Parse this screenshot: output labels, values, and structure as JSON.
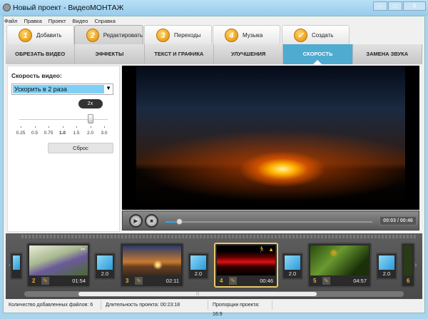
{
  "window": {
    "title": "Новый проект - ВидеоМОНТАЖ",
    "minimize": "–",
    "maximize": "□",
    "close": "X"
  },
  "menu": [
    "Файл",
    "Правка",
    "Проект",
    "Видео",
    "Справка"
  ],
  "steps": [
    {
      "num": "1",
      "label": "Добавить"
    },
    {
      "num": "2",
      "label": "Редактировать"
    },
    {
      "num": "3",
      "label": "Переходы"
    },
    {
      "num": "4",
      "label": "Музыка"
    },
    {
      "num": "✓",
      "label": "Создать"
    }
  ],
  "subtabs": [
    "ОБРЕЗАТЬ ВИДЕО",
    "ЭФФЕКТЫ",
    "ТЕКСТ И ГРАФИКА",
    "УЛУЧШЕНИЯ",
    "СКОРОСТЬ",
    "ЗАМЕНА ЗВУКА"
  ],
  "speed": {
    "label": "Скорость видео:",
    "selected": "Ускорить в 2 раза",
    "tooltip": "2x",
    "ticks": [
      "0.25",
      "0.5",
      "0.75",
      "1.0",
      "1.5",
      "2.0",
      "3.0"
    ],
    "value": 2.0,
    "reset": "Сброс"
  },
  "player": {
    "time": "00:03 / 00:46",
    "progress": 0.065
  },
  "clips": [
    {
      "num": "2",
      "duration": "01:54"
    },
    {
      "num": "3",
      "duration": "02:11"
    },
    {
      "num": "4",
      "duration": "00:46"
    },
    {
      "num": "5",
      "duration": "04:57"
    },
    {
      "num": "6"
    }
  ],
  "transitions": [
    "2.0",
    "2.0",
    "2.0",
    "2.0"
  ],
  "status": {
    "files": "Количество добавленных файлов: 6",
    "duration": "Длительность проекта:  00:23:18",
    "ratio": "Пропорции проекта:  16:9"
  }
}
